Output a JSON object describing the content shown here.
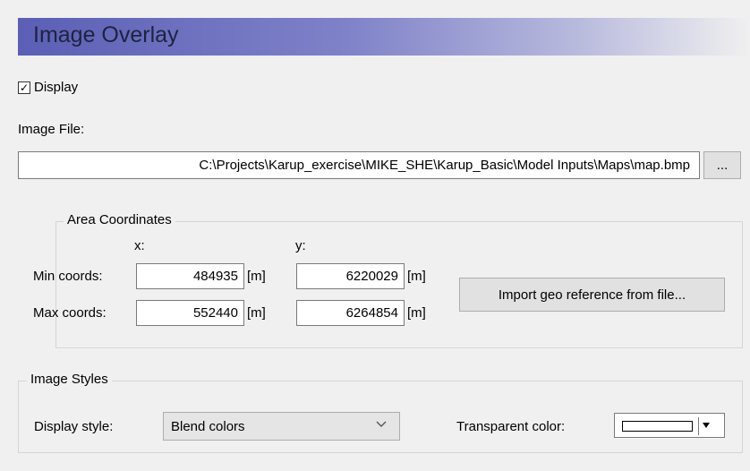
{
  "panel": {
    "title": "Image Overlay"
  },
  "display": {
    "label": "Display",
    "checked": true,
    "check_glyph": "✓"
  },
  "image_file": {
    "label": "Image File:",
    "path": "C:\\Projects\\Karup_exercise\\MIKE_SHE\\Karup_Basic\\Model Inputs\\Maps\\map.bmp",
    "browse_label": "..."
  },
  "area_coordinates": {
    "title": "Area Coordinates",
    "x_header": "x:",
    "y_header": "y:",
    "min_label": "Min coords:",
    "max_label": "Max coords:",
    "unit": "[m]",
    "min_x": "484935",
    "min_y": "6220029",
    "max_x": "552440",
    "max_y": "6264854",
    "import_button": "Import geo reference from file..."
  },
  "image_styles": {
    "title": "Image Styles",
    "display_style_label": "Display style:",
    "display_style_value": "Blend colors",
    "transparent_color_label": "Transparent color:",
    "transparent_color": "#ffffff"
  }
}
